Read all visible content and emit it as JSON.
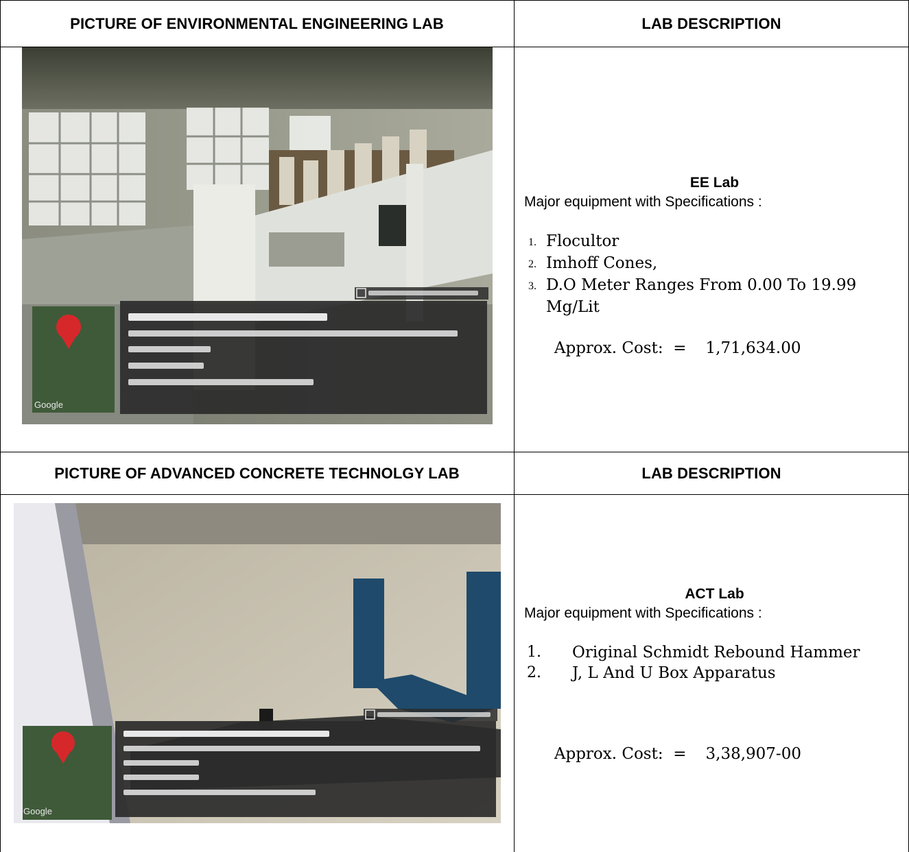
{
  "rows": [
    {
      "picture_header": "PICTURE OF ENVIRONMENTAL ENGINEERING LAB",
      "description_header": "LAB DESCRIPTION",
      "lab_title": "EE Lab",
      "subtitle": "Major equipment with Specifications :",
      "equipment": [
        {
          "num": "1.",
          "text": "Flocultor"
        },
        {
          "num": "2.",
          "text": "Imhoff  Cones,"
        },
        {
          "num": "3.",
          "text": "D.O Meter Ranges From 0.00 To 19.99"
        }
      ],
      "equipment_continuation": "Mg/Lit",
      "cost_label": "Approx. Cost:  =",
      "cost_value": "1,71,634.00"
    },
    {
      "picture_header": "PICTURE OF ADVANCED CONCRETE TECHNOLGY LAB",
      "description_header": "LAB DESCRIPTION",
      "lab_title": "ACT Lab",
      "subtitle": "Major equipment with Specifications :",
      "equipment": [
        {
          "num": "1.",
          "text": "Original Schmidt Rebound Hammer"
        },
        {
          "num": "2.",
          "text": "J, L And U Box Apparatus"
        }
      ],
      "cost_label": "Approx. Cost:  =",
      "cost_value": "3,38,907-00"
    }
  ],
  "photo_overlay_brand": "Google",
  "colors": {
    "overlay_bg": "#2b2b2b",
    "map_pin": "#d6282b",
    "wall_tone": "#c9c2b3",
    "blue_frame": "#1f4a6b"
  }
}
